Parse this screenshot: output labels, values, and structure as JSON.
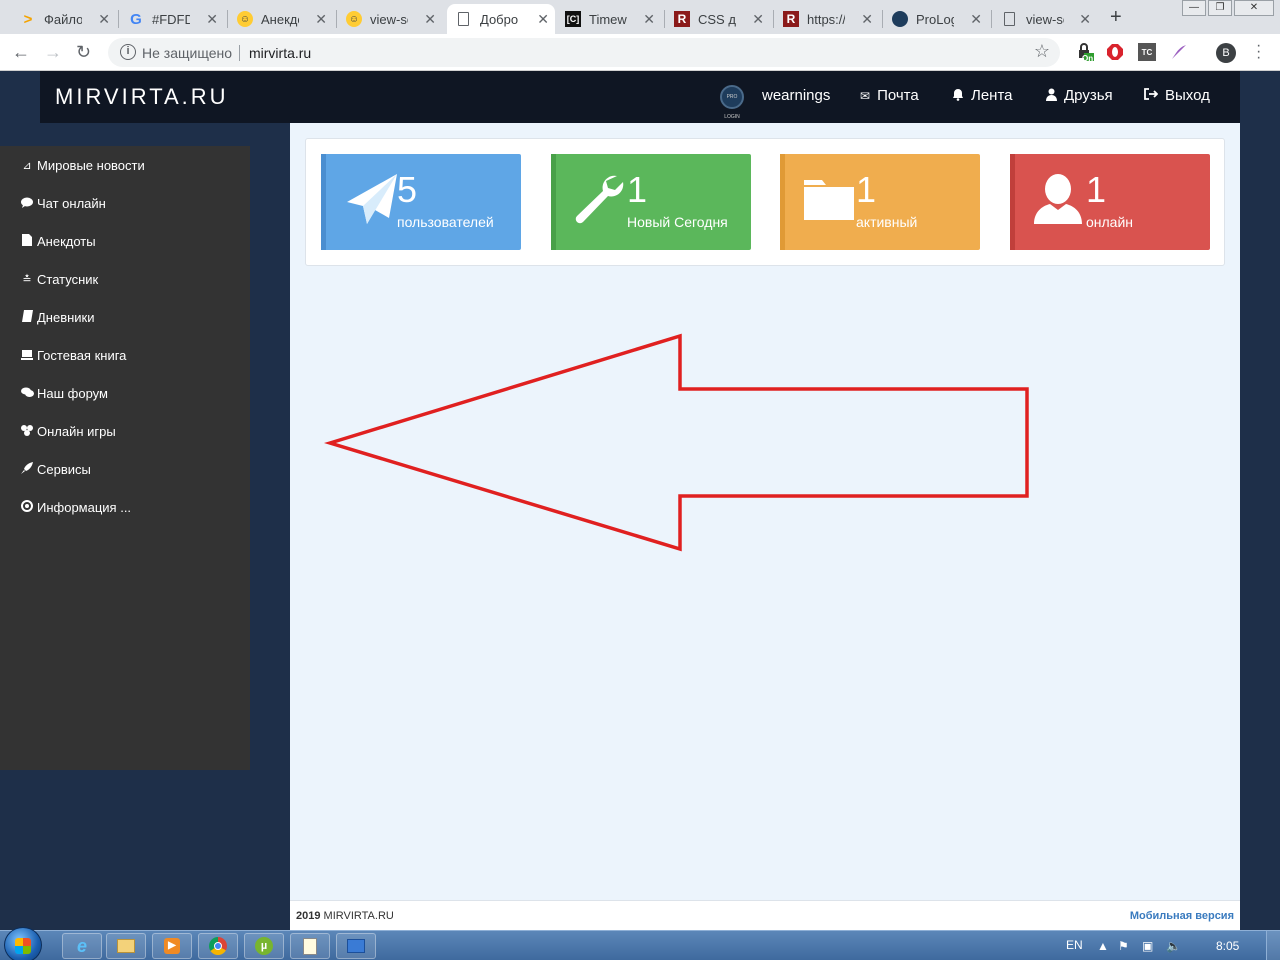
{
  "browser": {
    "tabs": [
      {
        "title": "Файловый",
        "icon": "chevron-icon"
      },
      {
        "title": "#FDFDFD",
        "icon": "google-icon"
      },
      {
        "title": "Анекдоты",
        "icon": "smiley-icon"
      },
      {
        "title": "view-source",
        "icon": "smiley-icon"
      },
      {
        "title": "Добро п",
        "icon": "page-icon"
      },
      {
        "title": "Timeweb",
        "icon": "timeweb-icon"
      },
      {
        "title": "CSS для",
        "icon": "r-icon"
      },
      {
        "title": "https://r",
        "icon": "r-icon"
      },
      {
        "title": "ProLogin",
        "icon": "prologin-icon"
      },
      {
        "title": "view-sou",
        "icon": "page-icon"
      }
    ],
    "address": {
      "security": "Не защищено",
      "url": "mirvirta.ru"
    },
    "extension_badge": "On",
    "profile_initial": "B"
  },
  "site": {
    "brand": "MIRVIRTA.RU",
    "avatar_text": "PRO LOGIN",
    "nav": {
      "username": "wearnings",
      "mail": "Почта",
      "feed": "Лента",
      "friends": "Друзья",
      "logout": "Выход"
    },
    "sidebar": [
      {
        "label": "Мировые новости",
        "icon": "rss-icon"
      },
      {
        "label": "Чат онлайн",
        "icon": "comment-icon"
      },
      {
        "label": "Анекдоты",
        "icon": "file-icon"
      },
      {
        "label": "Статусник",
        "icon": "stack-icon"
      },
      {
        "label": "Дневники",
        "icon": "book-icon"
      },
      {
        "label": "Гостевая книга",
        "icon": "guestbook-icon"
      },
      {
        "label": "Наш форум",
        "icon": "comments-icon"
      },
      {
        "label": "Онлайн игры",
        "icon": "gamepad-icon"
      },
      {
        "label": "Сервисы",
        "icon": "rocket-icon"
      },
      {
        "label": "Информация ...",
        "icon": "lifebuoy-icon"
      }
    ],
    "stats": [
      {
        "value": "5",
        "label": "пользователей",
        "color": "#5fa6e6",
        "bar": "#4a8ed0",
        "icon": "paper-plane-icon"
      },
      {
        "value": "1",
        "label": "Новый Сегодня",
        "color": "#5bb75b",
        "bar": "#48a048",
        "icon": "wrench-icon"
      },
      {
        "value": "1",
        "label": "активный",
        "color": "#f0ad4e",
        "bar": "#e09a36",
        "icon": "folder-icon"
      },
      {
        "value": "1",
        "label": "онлайн",
        "color": "#d9534f",
        "bar": "#c03f3b",
        "icon": "user-icon"
      }
    ],
    "footer": {
      "year": "2019",
      "site": "MIRVIRTA.RU",
      "mobile": "Мобильная версия"
    },
    "annotation_color": "#e02020"
  },
  "taskbar": {
    "language": "EN",
    "time": "8:05",
    "apps": [
      "ie-icon",
      "explorer-icon",
      "media-player-icon",
      "chrome-icon",
      "utorrent-icon",
      "notepad-icon",
      "control-panel-icon"
    ]
  }
}
